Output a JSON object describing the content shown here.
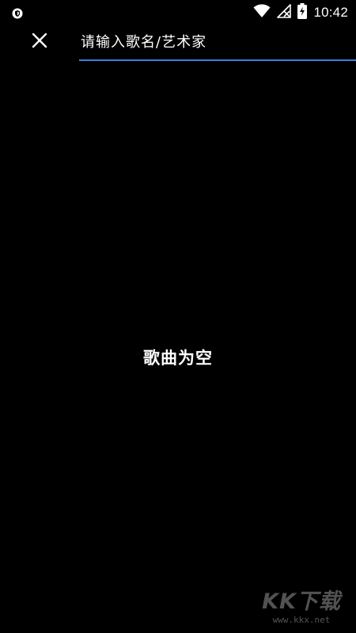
{
  "status_bar": {
    "time": "10:42",
    "left_icon": "shield-icon",
    "icons": [
      "wifi-icon",
      "signal-off-icon",
      "battery-charging-icon"
    ]
  },
  "search": {
    "placeholder": "请输入歌名/艺术家",
    "value": "",
    "close_icon": "close-icon",
    "underline_color": "#3d7de0"
  },
  "main": {
    "empty_message": "歌曲为空"
  },
  "watermark": {
    "logo": "KK下载",
    "url": "www.kkx.net"
  },
  "colors": {
    "background": "#000000",
    "text": "#ffffff",
    "accent": "#3d7de0"
  }
}
